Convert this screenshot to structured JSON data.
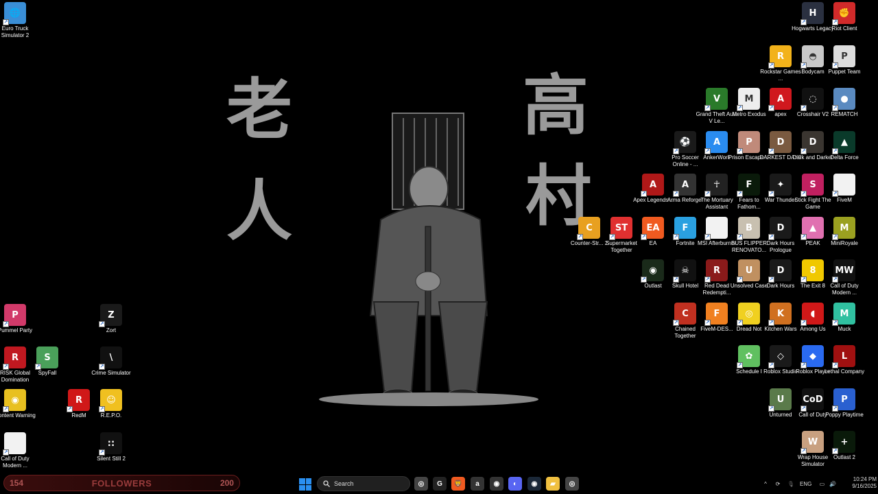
{
  "wallpaper": {
    "kanji": [
      "老",
      "人",
      "高",
      "村"
    ]
  },
  "desktop_icons": [
    {
      "label": "Euro Truck Simulator 2",
      "color": "#3a8ed6",
      "glyph": "🌐"
    },
    {
      "label": "Pummel Party",
      "color": "#d23a6a",
      "glyph": "P"
    },
    {
      "label": "Zort",
      "color": "#1a1a1a",
      "glyph": "Z"
    },
    {
      "label": "RISK Global Domination",
      "color": "#c01820",
      "glyph": "R"
    },
    {
      "label": "SpyFall",
      "color": "#4aa05a",
      "glyph": "S"
    },
    {
      "label": "Crime Simulator",
      "color": "#111111",
      "glyph": "\\"
    },
    {
      "label": "Content Warning",
      "color": "#e8c020",
      "glyph": "◉"
    },
    {
      "label": "RedM",
      "color": "#d01818",
      "glyph": "R"
    },
    {
      "label": "R.E.P.O.",
      "color": "#f0c020",
      "glyph": "☺"
    },
    {
      "label": "Call of Duty Modern ...",
      "color": "#f2f2f2",
      "glyph": ""
    },
    {
      "label": "Silent Still 2",
      "color": "#111111",
      "glyph": "::"
    },
    {
      "label": "Hogwarts Legacy",
      "color": "#2a3040",
      "glyph": "H"
    },
    {
      "label": "Riot Client",
      "color": "#d12a2a",
      "glyph": "✊"
    },
    {
      "label": "Rockstar Games ...",
      "color": "#f2b21a",
      "glyph": "R"
    },
    {
      "label": "Bodycam",
      "color": "#c8c8c8",
      "glyph": "◓"
    },
    {
      "label": "Puppet Team",
      "color": "#dddddd",
      "glyph": "P"
    },
    {
      "label": "Grand Theft Auto V Le...",
      "color": "#2a7a2a",
      "glyph": "V"
    },
    {
      "label": "Metro Exodus",
      "color": "#eeeeee",
      "glyph": "M"
    },
    {
      "label": "apex",
      "color": "#d0181e",
      "glyph": "A"
    },
    {
      "label": "Crosshair V2",
      "color": "#111111",
      "glyph": "◌"
    },
    {
      "label": "REMATCH",
      "color": "#5a8ac0",
      "glyph": "●"
    },
    {
      "label": "Pro Soccer Online - ...",
      "color": "#1a1a1a",
      "glyph": "⚽"
    },
    {
      "label": "AnkerWork",
      "color": "#2a8cf0",
      "glyph": "A"
    },
    {
      "label": "Prison Escape ...",
      "color": "#c08a7a",
      "glyph": "P"
    },
    {
      "label": "DARKEST DAYS",
      "color": "#7a5a40",
      "glyph": "D"
    },
    {
      "label": "Dark and Darker",
      "color": "#3a3530",
      "glyph": "D"
    },
    {
      "label": "Delta Force",
      "color": "#0a3a2a",
      "glyph": "▲"
    },
    {
      "label": "Apex Legends...",
      "color": "#b01818",
      "glyph": "A"
    },
    {
      "label": "Arma Reforger",
      "color": "#333333",
      "glyph": "A"
    },
    {
      "label": "The Mortuary Assistant",
      "color": "#222222",
      "glyph": "☥"
    },
    {
      "label": "Fears to Fathom...",
      "color": "#0a1a0a",
      "glyph": "F"
    },
    {
      "label": "War Thunder",
      "color": "#1a1a1a",
      "glyph": "✦"
    },
    {
      "label": "Stick Fight The Game",
      "color": "#c02060",
      "glyph": "S"
    },
    {
      "label": "FiveM",
      "color": "#f2f2f2",
      "glyph": ""
    },
    {
      "label": "Counter-Str... 2",
      "color": "#e8a020",
      "glyph": "C"
    },
    {
      "label": "Supermarket Together",
      "color": "#e03030",
      "glyph": "ST"
    },
    {
      "label": "EA",
      "color": "#f05a20",
      "glyph": "EA"
    },
    {
      "label": "Fortnite",
      "color": "#2aa0e0",
      "glyph": "F"
    },
    {
      "label": "MSI Afterburner",
      "color": "#f2f2f2",
      "glyph": ""
    },
    {
      "label": "BUS FLIPPER RENOVATO...",
      "color": "#c8c0b0",
      "glyph": "B"
    },
    {
      "label": "Dark Hours Prologue",
      "color": "#1a1a1a",
      "glyph": "D"
    },
    {
      "label": "PEAK",
      "color": "#e070b0",
      "glyph": "▲"
    },
    {
      "label": "MiniRoyale",
      "color": "#9aa020",
      "glyph": "M"
    },
    {
      "label": "Outlast",
      "color": "#1a2a1a",
      "glyph": "◉"
    },
    {
      "label": "Skull Hotel",
      "color": "#111111",
      "glyph": "☠"
    },
    {
      "label": "Red Dead Redempti...",
      "color": "#8a1a1a",
      "glyph": "R"
    },
    {
      "label": "Unsolved Case",
      "color": "#c09060",
      "glyph": "U"
    },
    {
      "label": "Dark Hours",
      "color": "#1a1a1a",
      "glyph": "D"
    },
    {
      "label": "The Exit 8",
      "color": "#f0c800",
      "glyph": "8"
    },
    {
      "label": "Call of Duty Modern ...",
      "color": "#111111",
      "glyph": "MW"
    },
    {
      "label": "Chained Together",
      "color": "#c03020",
      "glyph": "C"
    },
    {
      "label": "FiveM-DES...",
      "color": "#f08020",
      "glyph": "F"
    },
    {
      "label": "Dread Not",
      "color": "#f0d020",
      "glyph": "◎"
    },
    {
      "label": "Kitchen Wars",
      "color": "#d07020",
      "glyph": "K"
    },
    {
      "label": "Among Us",
      "color": "#d01818",
      "glyph": "◖"
    },
    {
      "label": "Muck",
      "color": "#30c0a0",
      "glyph": "M"
    },
    {
      "label": "Schedule I",
      "color": "#60c060",
      "glyph": "✿"
    },
    {
      "label": "Roblox Studio",
      "color": "#1a1a1a",
      "glyph": "◇"
    },
    {
      "label": "Roblox Player",
      "color": "#2a6af0",
      "glyph": "◆"
    },
    {
      "label": "Lethal Company",
      "color": "#a01010",
      "glyph": "L"
    },
    {
      "label": "Unturned",
      "color": "#5a7a4a",
      "glyph": "U"
    },
    {
      "label": "Call of Duty",
      "color": "#111111",
      "glyph": "CoD"
    },
    {
      "label": "Poppy Playtime",
      "color": "#2a60d0",
      "glyph": "P"
    },
    {
      "label": "Wrap House Simulator",
      "color": "#c8a080",
      "glyph": "W"
    },
    {
      "label": "Outlast 2",
      "color": "#0a1a0a",
      "glyph": "+"
    }
  ],
  "followers_widget": {
    "left_value": "154",
    "label": "FOLLOWERS",
    "right_value": "200"
  },
  "taskbar": {
    "search_placeholder": "Search",
    "apps": [
      {
        "name": "chatgpt",
        "glyph": "◎",
        "color": "#444444"
      },
      {
        "name": "logitech-g",
        "glyph": "G",
        "color": "#222222"
      },
      {
        "name": "brave",
        "glyph": "🦁",
        "color": "#f05a20"
      },
      {
        "name": "arc",
        "glyph": "a",
        "color": "#333333"
      },
      {
        "name": "obs",
        "glyph": "◉",
        "color": "#333333"
      },
      {
        "name": "discord",
        "glyph": "◐",
        "color": "#5865f2"
      },
      {
        "name": "steam",
        "glyph": "◉",
        "color": "#1b2838"
      },
      {
        "name": "file-explorer",
        "glyph": "▰",
        "color": "#f0c040"
      },
      {
        "name": "chatgpt-2",
        "glyph": "◎",
        "color": "#444444"
      }
    ],
    "language": "ENG",
    "time": "10:24 PM",
    "date": "9/16/2025"
  }
}
